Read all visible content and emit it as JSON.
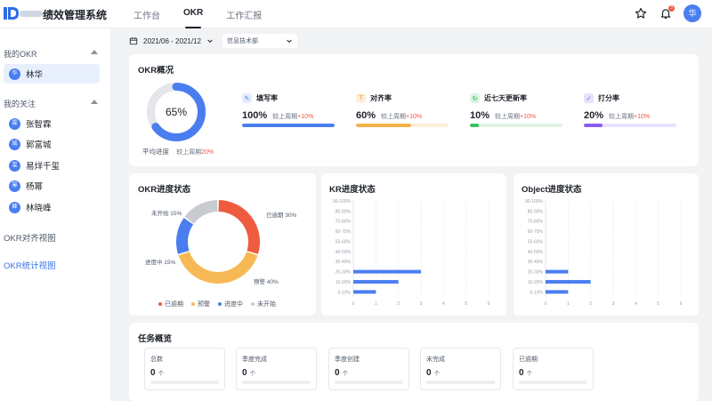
{
  "header": {
    "brand": "绩效管理系统",
    "nav": [
      "工作台",
      "OKR",
      "工作汇报"
    ],
    "active_nav": "OKR",
    "notification_count": "3",
    "avatar_text": "华"
  },
  "sidebar": {
    "my_okr_title": "我的OKR",
    "my_okr_users": [
      {
        "name": "林华",
        "initial": "华"
      }
    ],
    "following_title": "我的关注",
    "following_users": [
      {
        "name": "张智霖",
        "initial": "霖"
      },
      {
        "name": "郭富城",
        "initial": "城"
      },
      {
        "name": "易烊千玺",
        "initial": "玺"
      },
      {
        "name": "杨幂",
        "initial": "幂"
      },
      {
        "name": "林晓峰",
        "initial": "峰"
      }
    ],
    "links": [
      "OKR对齐视图",
      "OKR统计视图"
    ]
  },
  "filter": {
    "date_range": "2021/06 - 2021/12",
    "department": "信息技术部"
  },
  "okr_overview": {
    "title": "OKR概况",
    "avg_progress": {
      "value": "65%",
      "fraction": 0.65,
      "label": "平均进度",
      "compare": "较上周期",
      "delta": "20%"
    },
    "metrics": [
      {
        "name": "填写率",
        "value": "100%",
        "compare": "较上周期",
        "delta": "+10%",
        "fraction": 1.0,
        "color": "#4a7ef0",
        "track": "#e3ebfc",
        "icon_color": "#4a7ef0",
        "icon_bg": "#e3ebfc",
        "icon": "pencil-icon"
      },
      {
        "name": "对齐率",
        "value": "60%",
        "compare": "较上周期",
        "delta": "+10%",
        "fraction": 0.6,
        "color": "#f5b34a",
        "track": "#fdefd9",
        "icon_color": "#f5b34a",
        "icon_bg": "#fdefd9",
        "icon": "target-icon"
      },
      {
        "name": "近七天更新率",
        "value": "10%",
        "compare": "较上周期",
        "delta": "+10%",
        "fraction": 0.1,
        "color": "#3bc061",
        "track": "#dcf3e3",
        "icon_color": "#3bc061",
        "icon_bg": "#dcf3e3",
        "icon": "refresh-icon"
      },
      {
        "name": "打分率",
        "value": "20%",
        "compare": "较上周期",
        "delta": "+10%",
        "fraction": 0.2,
        "color": "#8a5cf0",
        "track": "#e8e0fc",
        "icon_color": "#8a5cf0",
        "icon_bg": "#e8e0fc",
        "icon": "check-icon"
      }
    ]
  },
  "okr_status": {
    "title": "OKR进度状态",
    "chart_data": {
      "type": "pie",
      "categories": [
        "已逾期",
        "预警",
        "进度中",
        "未开始"
      ],
      "values": [
        30,
        40,
        15,
        15
      ],
      "labels": [
        "已逾期 30%",
        "预警 40%",
        "进度中 15%",
        "未开始 15%"
      ],
      "colors": [
        "#ee5b3f",
        "#f7b955",
        "#4a7ef0",
        "#c8cbd0"
      ],
      "legend": "bottom"
    }
  },
  "kr_status": {
    "title": "KR进度状态",
    "chart_data": {
      "type": "bar",
      "orientation": "horizontal",
      "categories": [
        "90-100%",
        "80-90%",
        "70-80%",
        "60-70%",
        "50-60%",
        "40-50%",
        "30-40%",
        "20-30%",
        "10-20%",
        "0-10%"
      ],
      "values": [
        0,
        0,
        0,
        0,
        0,
        0,
        0,
        3,
        2,
        1
      ],
      "xlim": [
        0,
        6
      ],
      "xticks": [
        "0",
        "1",
        "2",
        "3",
        "4",
        "5",
        "6"
      ],
      "color": "#4a7ef0"
    }
  },
  "object_status": {
    "title": "Object进度状态",
    "chart_data": {
      "type": "bar",
      "orientation": "horizontal",
      "categories": [
        "90-100%",
        "80-90%",
        "70-80%",
        "60-70%",
        "50-60%",
        "40-50%",
        "30-40%",
        "20-30%",
        "10-20%",
        "0-10%"
      ],
      "values": [
        0,
        0,
        0,
        0,
        0,
        0,
        0,
        1,
        2,
        1
      ],
      "xlim": [
        0,
        6
      ],
      "xticks": [
        "0",
        "1",
        "2",
        "3",
        "4",
        "5",
        "6"
      ],
      "color": "#4a7ef0"
    }
  },
  "tasks": {
    "title": "任务概览",
    "unit": "个",
    "items": [
      {
        "label": "总数",
        "value": "0"
      },
      {
        "label": "季度完成",
        "value": "0"
      },
      {
        "label": "季度创建",
        "value": "0"
      },
      {
        "label": "未完成",
        "value": "0"
      },
      {
        "label": "已逾期",
        "value": "0"
      }
    ]
  }
}
